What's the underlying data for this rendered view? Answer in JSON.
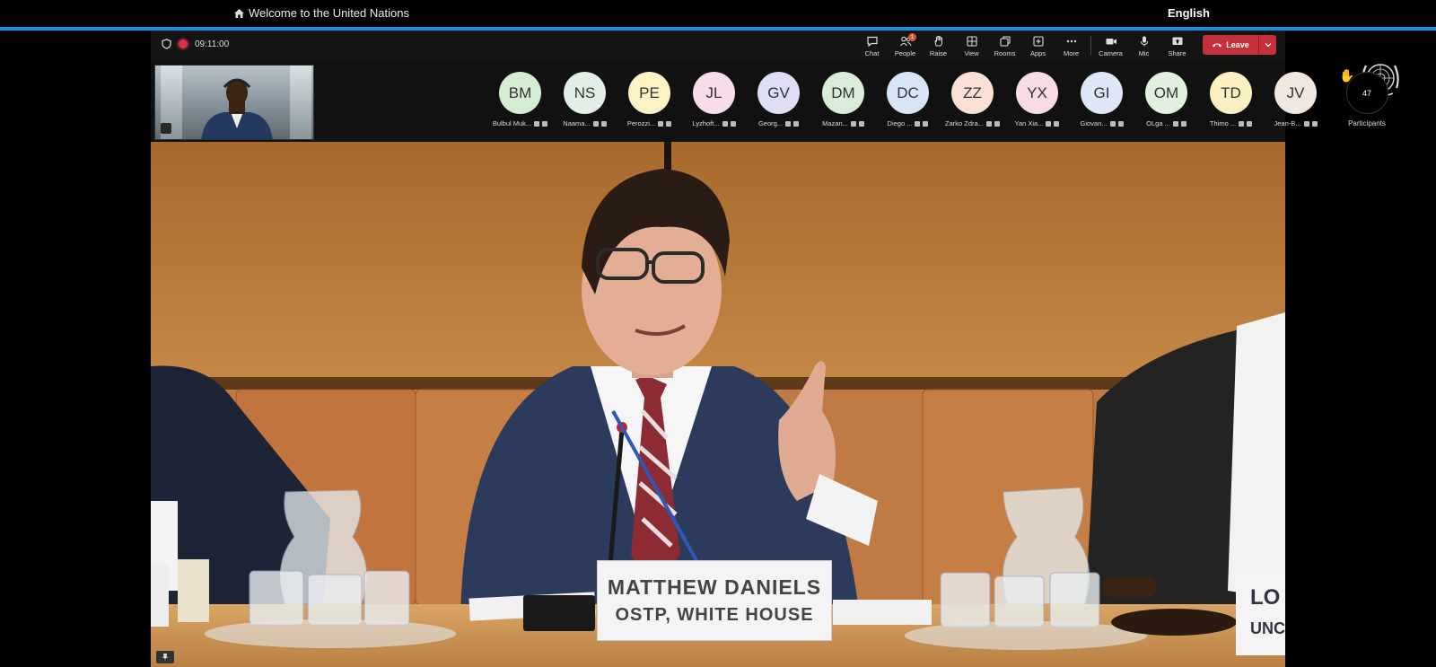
{
  "site": {
    "home_label": "Welcome to the United Nations",
    "language": "English"
  },
  "meeting": {
    "timer": "09:11:00",
    "toolbar": {
      "chat": "Chat",
      "people": "People",
      "people_badge": "1",
      "raise": "Raise",
      "view": "View",
      "rooms": "Rooms",
      "apps": "Apps",
      "more": "More",
      "camera": "Camera",
      "mic": "Mic",
      "share": "Share",
      "leave": "Leave"
    },
    "participants": [
      {
        "initials": "BM",
        "name": "Bulbul Muk...",
        "color": "#d3ecd2"
      },
      {
        "initials": "NS",
        "name": "Naama...",
        "color": "#e3efe4"
      },
      {
        "initials": "PE",
        "name": "Perozzi...",
        "color": "#fbf3c4"
      },
      {
        "initials": "JL",
        "name": "Lyzhoft...",
        "color": "#f6dde9"
      },
      {
        "initials": "GV",
        "name": "Georg...",
        "color": "#dcdff5"
      },
      {
        "initials": "DM",
        "name": "Mazan...",
        "color": "#d8ecd9"
      },
      {
        "initials": "DC",
        "name": "Diego ...",
        "color": "#d7e5f6"
      },
      {
        "initials": "ZZ",
        "name": "Zarko Zdra...",
        "color": "#fbe0d6"
      },
      {
        "initials": "YX",
        "name": "Yan Xia...",
        "color": "#f7dce8"
      },
      {
        "initials": "GI",
        "name": "Giovan...",
        "color": "#dfe6f7"
      },
      {
        "initials": "OM",
        "name": "OLga ...",
        "color": "#e2f0df"
      },
      {
        "initials": "TD",
        "name": "Thimo ...",
        "color": "#fbf0c2"
      },
      {
        "initials": "JV",
        "name": "Jean-B...",
        "color": "#f1e7e1"
      }
    ],
    "participants_count": "47",
    "participants_label": "Participants",
    "nameplate": {
      "name": "MATTHEW DANIELS",
      "org": "OSTP, WHITE HOUSE"
    },
    "side_plate": {
      "line1": "LO",
      "line2": "UNC"
    },
    "colors": {
      "leave": "#c4313b",
      "accent_rule": "#1a8fd1",
      "recording": "#d8344a"
    }
  }
}
